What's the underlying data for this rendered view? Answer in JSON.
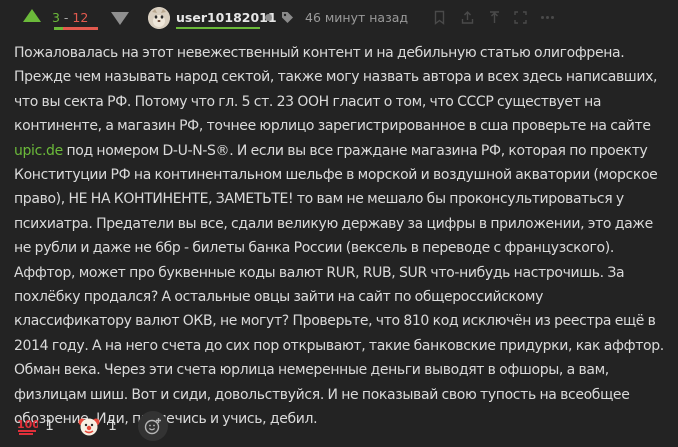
{
  "comment": {
    "rating_plus": "3",
    "rating_sep": " - ",
    "rating_minus": "12",
    "rating_plus_fraction": 0.2,
    "author": "user10182011",
    "time": "46 минут назад",
    "link_text": "upic.de",
    "text_part1": "Пожаловалась на этот невежественный контент и на дебильную статью олигофрена. Прежде чем называть народ сектой, также могу назвать автора и всех здесь написавших, что вы секта РФ. Потому что гл. 5 ст. 23 ООН гласит о том, что СССР существует на континенте, а магазин РФ, точнее юрлицо зарегистрированное в сша проверьте на сайте ",
    "text_part2": " под номером D-U-N-S®. И если вы все граждане магазина РФ, которая по проекту Конституции РФ на континентальном шельфе в морской и воздушной акватории (морское право), НЕ НА КОНТИНЕНТЕ, ЗАМЕТЬТЕ! то вам не мешало бы проконсультироваться у психиатра. Предатели вы все, сдали великую державу за цифры в приложении, это даже не рубли и даже не 6бр - билеты банка России (вексель в переводе с французского). Аффтор, может про буквенные коды валют RUR, RUB, SUR что-нибудь настрочишь. За похлёбку продался? А остальные овцы зайти на сайт по общероссийскому классификатору валют ОКВ, не могут? Проверьте, что 810 код исключён из реестра ещё в 2014 году. А на него счета до сих пор открывают, такие банковские придурки, как аффтор. Обман века. Через эти счета юрлица немеренные деньги выводят в офшоры, а вам, физлицам шиш. Вот и сиди, довольствуйся. И не показывай свою тупость на всеобщее обозрение. Иди, пролечись и учись, дебил."
  },
  "reactions": [
    {
      "emoji": "💯",
      "name": "hundred-points",
      "count": "1"
    },
    {
      "emoji": "🤡",
      "name": "clown-face",
      "count": "1"
    }
  ],
  "colors": {
    "background": "#232323",
    "accent_green": "#6bba3a",
    "accent_red": "#e2594e",
    "text": "#dadada",
    "muted": "#9a9a9a"
  },
  "icons": [
    "arrow-up-icon",
    "arrow-down-icon",
    "tag-icon",
    "bookmark-icon",
    "share-icon",
    "pin-icon",
    "expand-icon",
    "more-icon",
    "add-reaction-icon"
  ]
}
